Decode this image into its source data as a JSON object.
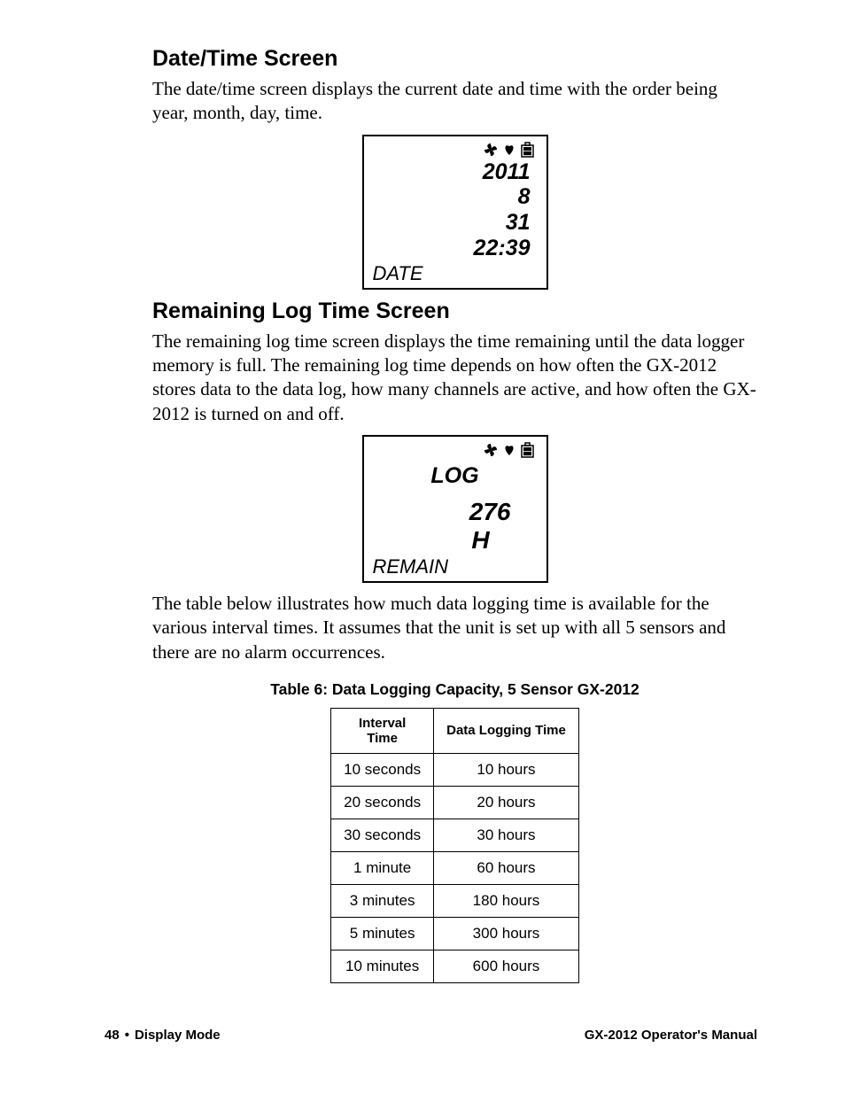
{
  "section1": {
    "heading": "Date/Time Screen",
    "paragraph": "The date/time screen displays the current date and time with the order being year, month, day, time."
  },
  "lcd1": {
    "year": "2011",
    "month": "8",
    "day": "31",
    "time": "22:39",
    "label": "DATE"
  },
  "section2": {
    "heading": "Remaining Log Time Screen",
    "paragraph": "The remaining log time screen displays the time remaining until the data logger memory is full. The remaining log time depends on how often the GX-2012 stores data to the data log, how many channels are active, and how often the GX-2012 is turned on and off."
  },
  "lcd2": {
    "title": "LOG",
    "value": "276",
    "unit": "H",
    "label": "REMAIN"
  },
  "section3": {
    "paragraph": "The table below illustrates how much data logging time is available for the various interval times. It assumes that the unit is set up with all 5 sensors and there are no alarm occurrences."
  },
  "table": {
    "caption": "Table 6: Data Logging Capacity, 5 Sensor GX-2012",
    "headers": [
      "Interval Time",
      "Data Logging Time"
    ],
    "rows": [
      [
        "10 seconds",
        "10 hours"
      ],
      [
        "20 seconds",
        "20 hours"
      ],
      [
        "30 seconds",
        "30 hours"
      ],
      [
        "1 minute",
        "60 hours"
      ],
      [
        "3 minutes",
        "180 hours"
      ],
      [
        "5 minutes",
        "300 hours"
      ],
      [
        "10 minutes",
        "600 hours"
      ]
    ]
  },
  "footer": {
    "page": "48",
    "bullet": "•",
    "left": "Display Mode",
    "right": "GX-2012 Operator's Manual"
  }
}
